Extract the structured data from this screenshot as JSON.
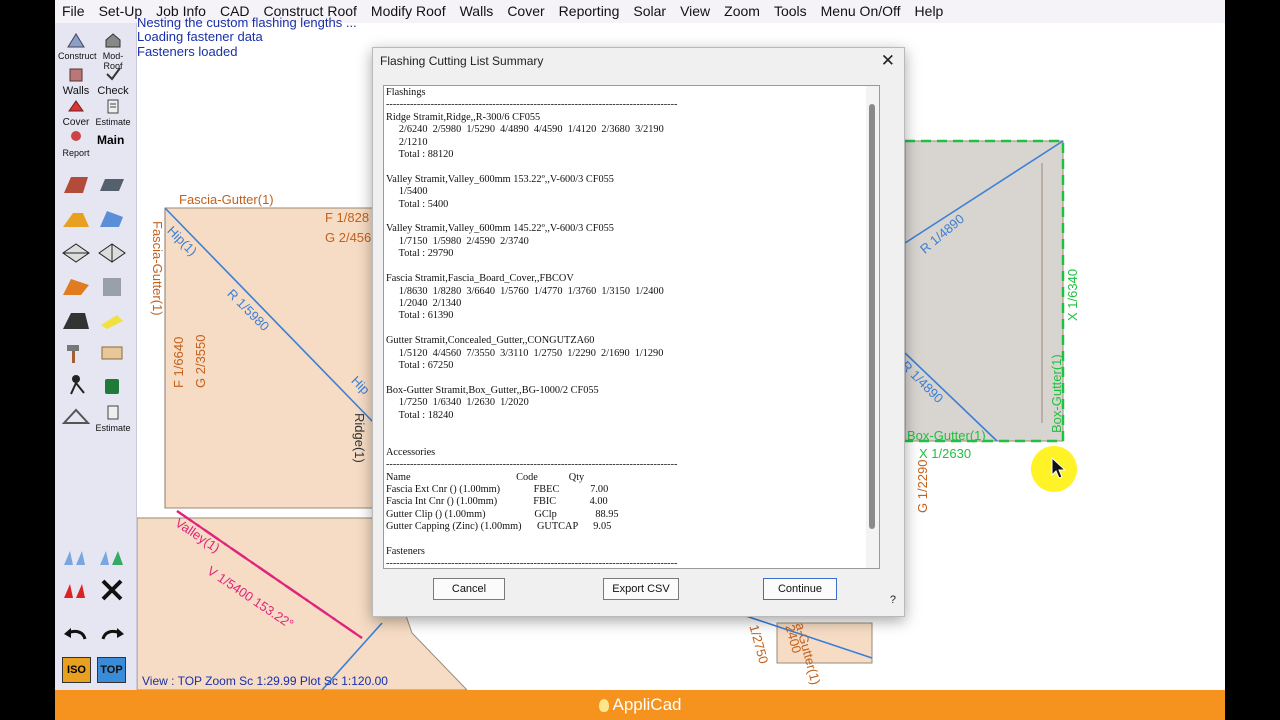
{
  "menu": [
    "File",
    "Set-Up",
    "Job Info",
    "CAD",
    "Construct Roof",
    "Modify Roof",
    "Walls",
    "Cover",
    "Reporting",
    "Solar",
    "View",
    "Zoom",
    "Tools",
    "Menu On/Off",
    "Help"
  ],
  "toolbar": {
    "construct": "Construct",
    "mod_roof": "Mod-Roof",
    "walls": "Walls",
    "check": "Check",
    "cover": "Cover",
    "estimate": "Estimate",
    "report": "Report",
    "main": "Main",
    "estimate2": "Estimate",
    "iso": "ISO",
    "top": "TOP"
  },
  "messages": [
    "Nesting the custom flashing lengths ...",
    "Loading fastener data",
    "Fasteners loaded"
  ],
  "cad_labels": {
    "fascia_gutter_top": "Fascia-Gutter(1)",
    "f_top": "F 1/828",
    "g_top": "G 2/456",
    "hip": "Hip(1)",
    "fascia_gutter_left": "Fascia-Gutter(1)",
    "f_left": "F 1/6640",
    "g_left": "G 2/3550",
    "r_left": "R 1/5980",
    "ridge": "Ridge(1)",
    "hip2": "Hip",
    "valley": "Valley(1)",
    "v_label": "V 1/5400 153.22°",
    "r_right": "R 1/4890",
    "x_right": "X 1/6340",
    "r_right2": "R 1/4890",
    "box_gutter_vert": "Box-Gutter(1)",
    "box_gutter": "Box-Gutter(1)",
    "x_bottom": "X 1/2630",
    "g_bottom": "G 1/2290",
    "num_bottom": "1/2750",
    "num2": "2400",
    "fascia_gutter_br": "a-Gutter(1)"
  },
  "status": "View : TOP  Zoom Sc 1:29.99  Plot Sc 1:120.00",
  "brand": "AppliCad",
  "dialog": {
    "title": "Flashing Cutting List Summary",
    "close": "✕",
    "report_text": "Flashings\n-------------------------------------------------------------------------------------\nRidge Stramit,Ridge,,R-300/6 CF055\n     2/6240  2/5980  1/5290  4/4890  4/4590  1/4120  2/3680  3/2190\n     2/1210\n     Total : 88120\n\nValley Stramit,Valley_600mm 153.22º,,V-600/3 CF055\n     1/5400\n     Total : 5400\n\nValley Stramit,Valley_600mm 145.22º,,V-600/3 CF055\n     1/7150  1/5980  2/4590  2/3740\n     Total : 29790\n\nFascia Stramit,Fascia_Board_Cover,,FBCOV\n     1/8630  1/8280  3/6640  1/5760  1/4770  1/3760  1/3150  1/2400\n     1/2040  2/1340\n     Total : 61390\n\nGutter Stramit,Concealed_Gutter,,CONGUTZA60\n     1/5120  4/4560  7/3550  3/3110  1/2750  1/2290  2/1690  1/1290\n     Total : 67250\n\nBox-Gutter Stramit,Box_Gutter,,BG-1000/2 CF055\n     1/7250  1/6340  1/2630  1/2020\n     Total : 18240\n\n\nAccessories\n-------------------------------------------------------------------------------------\nName                                         Code            Qty\nFascia Ext Cnr () (1.00mm)             FBEC            7.00\nFascia Int Cnr () (1.00mm)              FBIC             4.00\nGutter Clip () (1.00mm)                   GClp               88.95\nGutter Capping (Zinc) (1.00mm)      GUTCAP      9.05\n\nFasteners\n-------------------------------------------------------------------------------------",
    "buttons": {
      "cancel": "Cancel",
      "export": "Export CSV",
      "continue": "Continue"
    },
    "help": "?"
  },
  "colors": {
    "roof_fill": "#f6dcc4",
    "blue_line": "#3b7fd6",
    "magenta": "#e0247e",
    "green": "#20c040",
    "label_orange": "#c2611c",
    "accent": "#f6921e"
  }
}
